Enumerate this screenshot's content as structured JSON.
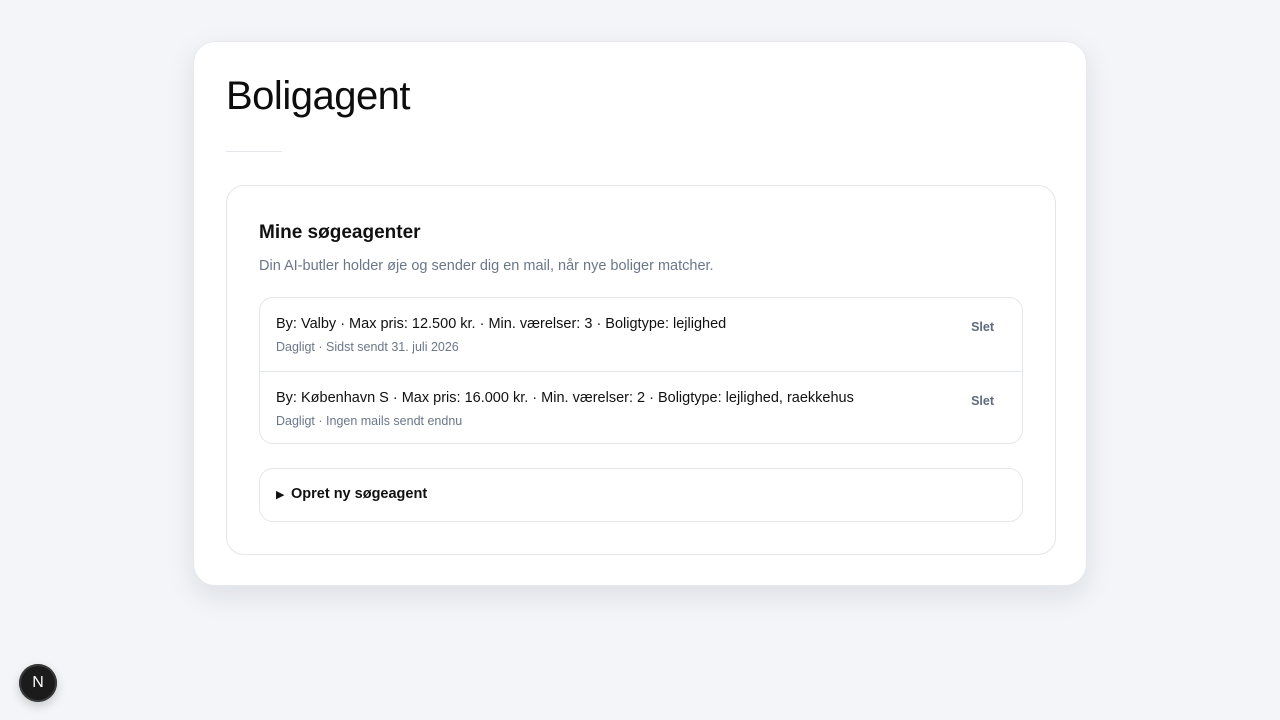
{
  "page": {
    "title": "Boligagent"
  },
  "agents_panel": {
    "title": "Mine søgeagenter",
    "subtitle": "Din AI-butler holder øje og sender dig en mail, når nye boliger matcher.",
    "agents": [
      {
        "criteria": "By: Valby · Max pris: 12.500 kr. · Min. værelser: 3 · Boligtype: lejlighed",
        "meta": "Dagligt · Sidst sendt 31. juli 2026",
        "delete_label": "Slet"
      },
      {
        "criteria": "By: København S · Max pris: 16.000 kr. · Min. værelser: 2 · Boligtype: lejlighed, raekkehus",
        "meta": "Dagligt · Ingen mails sendt endnu",
        "delete_label": "Slet"
      }
    ],
    "create": {
      "arrow": "▶",
      "label": "Opret ny søgeagent"
    }
  },
  "dev_badge": {
    "letter": "N",
    "icon": "nextjs-logo-icon"
  },
  "colors": {
    "background": "#f3f5f8",
    "card": "#ffffff",
    "border": "#e3e6ea",
    "muted_text": "#6b7789",
    "badge": "#1b1b1b"
  }
}
